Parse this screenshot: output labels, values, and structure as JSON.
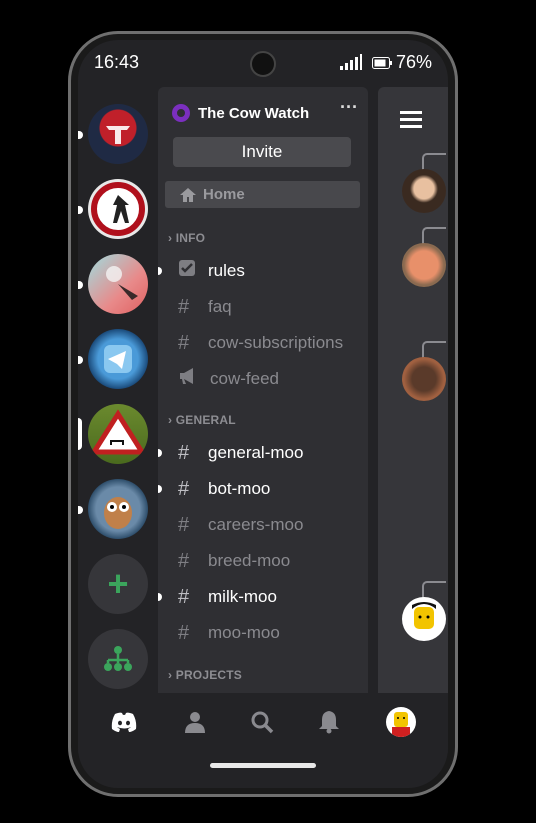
{
  "status_bar": {
    "time": "16:43",
    "battery": "76%"
  },
  "servers": [
    {
      "name": "server-1",
      "has_unread": true,
      "color": "#c0202a"
    },
    {
      "name": "server-2",
      "has_unread": true,
      "color": "#d8d8d8"
    },
    {
      "name": "server-3",
      "has_unread": true,
      "color": "#e07070"
    },
    {
      "name": "server-4",
      "has_unread": true,
      "color": "#2a7ab8"
    },
    {
      "name": "server-5",
      "selected": true,
      "color": "#c03020"
    },
    {
      "name": "server-6",
      "has_unread": true,
      "color": "#3a5f7a"
    }
  ],
  "rail_actions": {
    "add_server": "+",
    "discover": "discover-icon"
  },
  "guild": {
    "name": "The Cow Watch",
    "more": "···",
    "invite_label": "Invite",
    "home_label": "Home"
  },
  "categories": {
    "info": "INFO",
    "general": "GENERAL",
    "projects": "PROJECTS"
  },
  "channels": {
    "info": [
      {
        "name": "rules",
        "icon": "checkbox-icon",
        "active": true,
        "unread": true
      },
      {
        "name": "faq",
        "icon": "hash-icon",
        "active": false
      },
      {
        "name": "cow-subscriptions",
        "icon": "hash-icon",
        "active": false
      },
      {
        "name": "cow-feed",
        "icon": "megaphone-icon",
        "active": false
      }
    ],
    "general": [
      {
        "name": "general-moo",
        "icon": "hash-icon",
        "active": true,
        "unread": true
      },
      {
        "name": "bot-moo",
        "icon": "hash-icon",
        "active": true,
        "unread": true
      },
      {
        "name": "careers-moo",
        "icon": "hash-icon",
        "active": false
      },
      {
        "name": "breed-moo",
        "icon": "hash-icon",
        "active": false
      },
      {
        "name": "milk-moo",
        "icon": "hash-icon",
        "active": true,
        "unread": true
      },
      {
        "name": "moo-moo",
        "icon": "hash-icon",
        "active": false
      }
    ]
  },
  "bottom_nav": [
    "discord-icon",
    "friends-icon",
    "search-icon",
    "notifications-icon",
    "profile-avatar"
  ],
  "colors": {
    "accent_green": "#3ba55c",
    "guild_icon": "#7b2fbf",
    "panel_bg": "#2f2f33"
  }
}
